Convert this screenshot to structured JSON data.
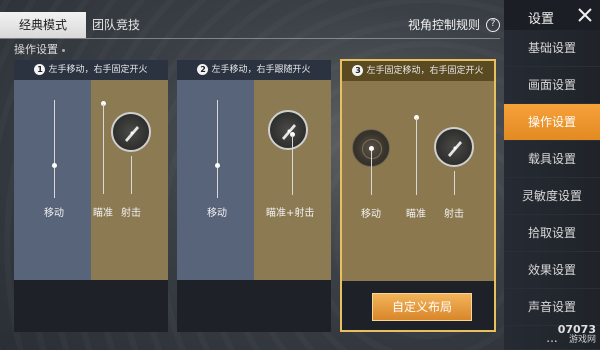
{
  "tabs": {
    "classic": "经典模式",
    "team": "团队竞技"
  },
  "view_rules": "视角控制规则",
  "section_label": "操作设置",
  "panels": [
    {
      "num": "1",
      "title": "左手移动，右手固定开火",
      "move": "移动",
      "aim": "瞄准",
      "shoot": "射击"
    },
    {
      "num": "2",
      "title": "左手移动，右手跟随开火",
      "move": "移动",
      "aim_shoot": "瞄准+射击"
    },
    {
      "num": "3",
      "title": "左手固定移动，右手固定开火",
      "move": "移动",
      "aim": "瞄准",
      "shoot": "射击",
      "button": "自定义布局"
    }
  ],
  "sidebar": {
    "title": "设置",
    "items": [
      {
        "label": "基础设置"
      },
      {
        "label": "画面设置"
      },
      {
        "label": "操作设置"
      },
      {
        "label": "载具设置"
      },
      {
        "label": "灵敏度设置"
      },
      {
        "label": "拾取设置"
      },
      {
        "label": "效果设置"
      },
      {
        "label": "声音设置"
      },
      {
        "label": "..."
      }
    ]
  },
  "watermark": {
    "number": "07073",
    "sub": "游戏网"
  },
  "colors": {
    "accent": "#f0a33c",
    "selected_border": "#e8c060"
  }
}
